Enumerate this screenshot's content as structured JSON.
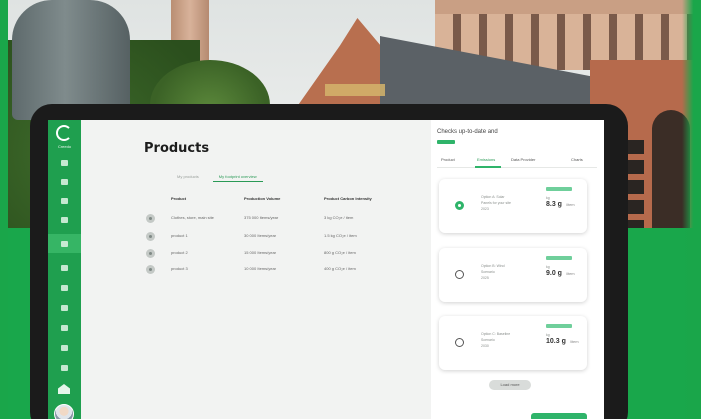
{
  "app": {
    "logo_label": "Creedo"
  },
  "sidebar": {
    "items": [
      "dashboard",
      "reports",
      "products",
      "suppliers",
      "settings",
      "analytics",
      "targets",
      "insights",
      "documents",
      "billing",
      "help"
    ]
  },
  "main": {
    "title": "Products",
    "tabs": [
      "My products",
      "My footprint overview"
    ],
    "columns": [
      "Product",
      "Production Volume",
      "Product Carbon Intensity"
    ],
    "rows": [
      {
        "product": "Clothes, store, main site",
        "volume": "375 000 Items/year",
        "intensity": "3 kg CO₂e / item"
      },
      {
        "product": "product 1",
        "volume": "30 000 Items/year",
        "intensity": "1.5 kg CO₂e / item"
      },
      {
        "product": "product 2",
        "volume": "15 000 Items/year",
        "intensity": "800 g CO₂e / item"
      },
      {
        "product": "product 3",
        "volume": "10 000 Items/year",
        "intensity": "400 g CO₂e / item"
      }
    ]
  },
  "panel": {
    "title": "Checks up-to-date and",
    "tabs": [
      "Product",
      "Emissions",
      "Data Provider",
      "Charts"
    ],
    "active_tab": 1,
    "cards": [
      {
        "selected": true,
        "lines": [
          "Option A: Solar",
          "Panels for your site",
          "2023"
        ],
        "label": "kg",
        "value": "8.3 g",
        "unit": "/item"
      },
      {
        "selected": false,
        "lines": [
          "Option B: Wind",
          "Scenario",
          "2025"
        ],
        "label": "kg",
        "value": "9.0 g",
        "unit": "/item"
      },
      {
        "selected": false,
        "lines": [
          "Option C: Baseline",
          "Scenario",
          "2030"
        ],
        "label": "kg",
        "value": "10.3 g",
        "unit": "/item"
      }
    ],
    "load_more": "Load more"
  },
  "colors": {
    "brand_green": "#1f9f4f",
    "accent_green": "#2fb46a"
  }
}
